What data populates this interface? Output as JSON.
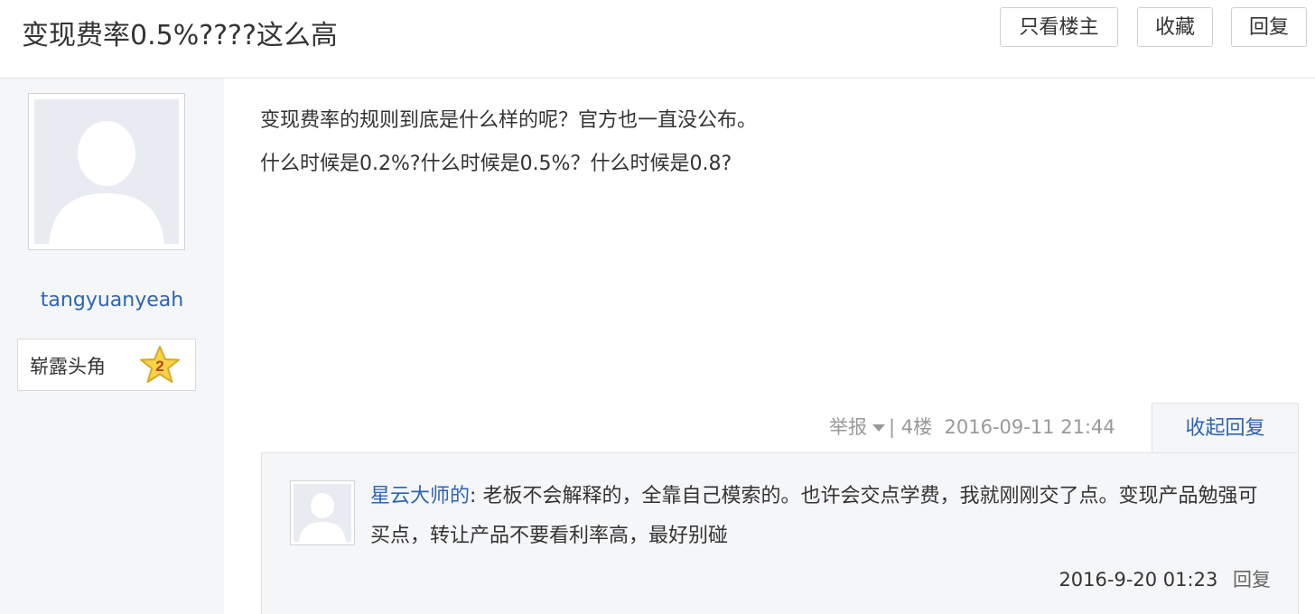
{
  "header": {
    "title": "变现费率0.5%????这么高",
    "buttons": {
      "only_op": "只看楼主",
      "favorite": "收藏",
      "reply": "回复"
    }
  },
  "user": {
    "username": "tangyuanyeah",
    "rank_label": "崭露头角",
    "rank_level": "2"
  },
  "post": {
    "lines": [
      "变现费率的规则到底是什么样的呢？官方也一直没公布。",
      "什么时候是0.2%?什么时候是0.5%？什么时候是0.8?"
    ],
    "meta": {
      "report": "举报",
      "separator": "|",
      "floor": "4楼",
      "datetime": "2016-09-11 21:44"
    },
    "collapse_label": "收起回复"
  },
  "reply": {
    "author": "星云大师的",
    "colon": ":",
    "text": "老板不会解释的，全靠自己模索的。也许会交点学费，我就刚刚交了点。变现产品勉强可买点，转让产品不要看利率高，最好别碰",
    "datetime": "2016-9-20 01:23",
    "reply_label": "回复"
  },
  "colors": {
    "link": "#2d64b3",
    "panel_bg": "#f5f6f8",
    "meta_gray": "#999999"
  },
  "icons": {
    "avatar": "default-avatar-silhouette",
    "rank": "star-badge-icon",
    "dropdown": "caret-down-icon"
  }
}
